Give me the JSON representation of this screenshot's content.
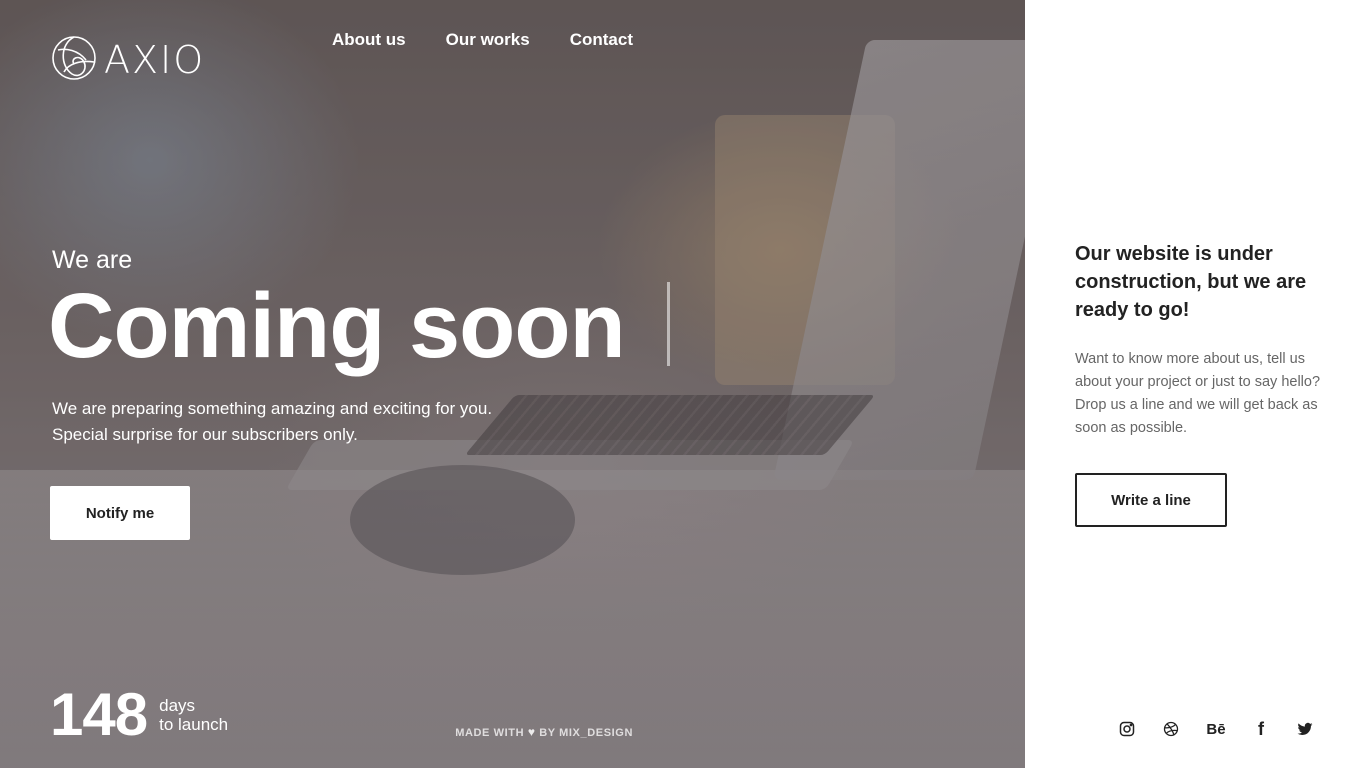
{
  "brand": {
    "name": "AXIO"
  },
  "nav": {
    "items": [
      {
        "label": "About us"
      },
      {
        "label": "Our works"
      },
      {
        "label": "Contact"
      }
    ]
  },
  "hero": {
    "eyebrow": "We are",
    "headline": "Coming soon",
    "lede_line1": "We are preparing something amazing and exciting for you.",
    "lede_line2": "Special surprise for our subscribers only.",
    "notify_label": "Notify me"
  },
  "countdown": {
    "value": "148",
    "unit": "days",
    "suffix": "to launch"
  },
  "footer": {
    "made_with_prefix": "MADE WITH",
    "made_with_suffix": "BY MIX_DESIGN"
  },
  "panel": {
    "title": "Our website is under construction, but we are ready to go!",
    "text": "Want to know more about us, tell us about your project or just to say hello? Drop us a line and we will get back as soon as possible.",
    "button_label": "Write a line"
  },
  "social": {
    "icons": [
      "instagram-icon",
      "dribbble-icon",
      "behance-icon",
      "facebook-icon",
      "twitter-icon"
    ],
    "behance_text": "Bē",
    "facebook_text": "f"
  },
  "colors": {
    "panel_bg": "#ffffff",
    "text_dark": "#222222",
    "text_muted": "#666666",
    "hero_text": "#ffffff"
  }
}
